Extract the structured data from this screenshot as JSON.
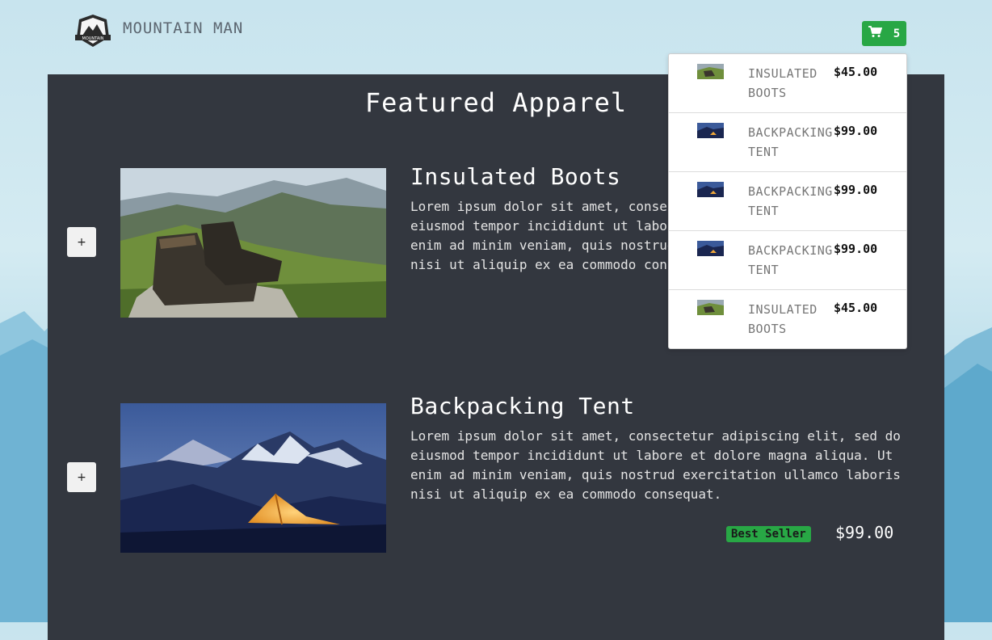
{
  "header": {
    "brand": "MOUNTAIN MAN",
    "logo_text": "MOUNTAIN",
    "cart_count": "5"
  },
  "main": {
    "title": "Featured Apparel",
    "products": [
      {
        "name": "Insulated Boots",
        "description": "Lorem ipsum dolor sit amet, consectetur adipiscing elit, sed do eiusmod tempor incididunt ut labore et dolore magna aliqua. Ut enim ad minim veniam, quis nostrud exercitation ullamco laboris nisi ut aliquip ex ea commodo consequat.",
        "add_label": "+",
        "image": "boots-on-mountain"
      },
      {
        "name": "Backpacking Tent",
        "description": "Lorem ipsum dolor sit amet, consectetur adipiscing elit, sed do eiusmod tempor incididunt ut labore et dolore magna aliqua. Ut enim ad minim veniam, quis nostrud exercitation ullamco laboris nisi ut aliquip ex ea commodo consequat.",
        "add_label": "+",
        "badge": "Best Seller",
        "price": "$99.00",
        "image": "tent-at-night"
      }
    ]
  },
  "cart": {
    "items": [
      {
        "name": "INSULATED BOOTS",
        "price": "$45.00",
        "thumb": "boots"
      },
      {
        "name": "BACKPACKING TENT",
        "price": "$99.00",
        "thumb": "tent"
      },
      {
        "name": "BACKPACKING TENT",
        "price": "$99.00",
        "thumb": "tent"
      },
      {
        "name": "BACKPACKING TENT",
        "price": "$99.00",
        "thumb": "tent"
      },
      {
        "name": "INSULATED BOOTS",
        "price": "$45.00",
        "thumb": "boots"
      }
    ]
  },
  "colors": {
    "accent": "#28a745",
    "panel": "#33373f",
    "background": "#c8e4ee"
  },
  "icons": {
    "cart": "shopping-cart-icon",
    "logo": "mountain-badge-logo"
  }
}
